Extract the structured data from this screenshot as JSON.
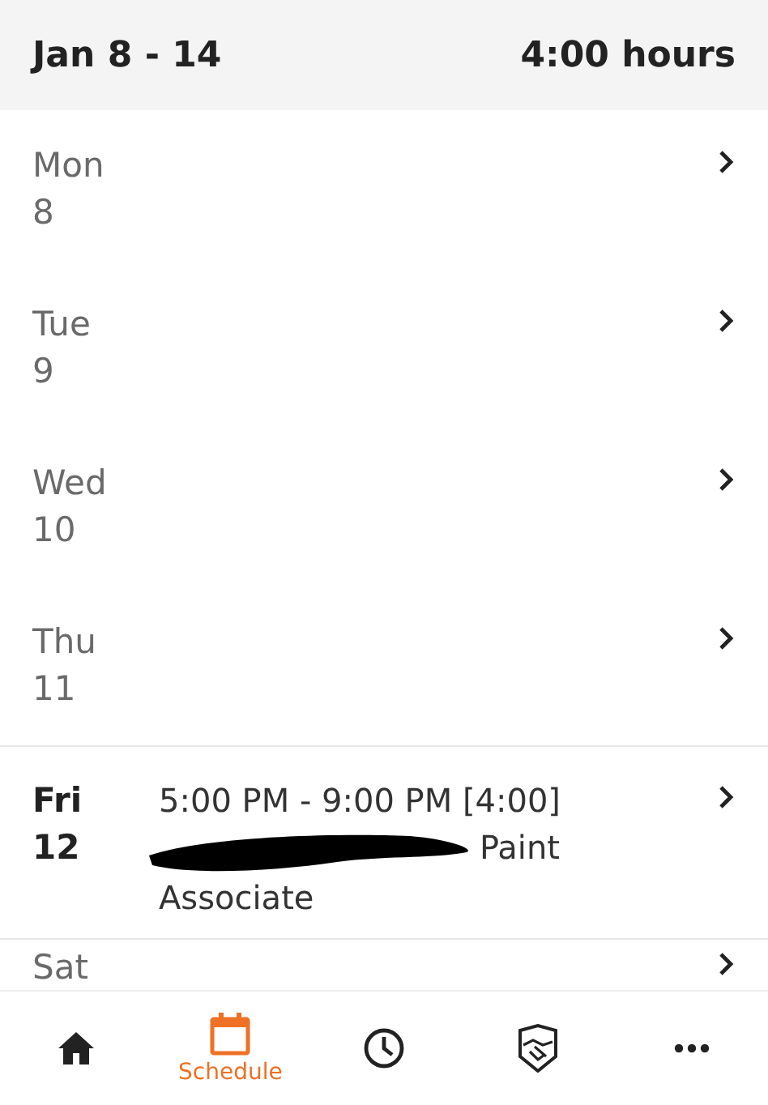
{
  "header": {
    "range": "Jan 8 - 14",
    "total": "4:00 hours"
  },
  "days": [
    {
      "name": "Mon",
      "date": "8",
      "has_shift": false
    },
    {
      "name": "Tue",
      "date": "9",
      "has_shift": false
    },
    {
      "name": "Wed",
      "date": "10",
      "has_shift": false
    },
    {
      "name": "Thu",
      "date": "11",
      "has_shift": false
    },
    {
      "name": "Fri",
      "date": "12",
      "has_shift": true,
      "shift": {
        "time": "5:00 PM - 9:00 PM [4:00]",
        "role_lines": [
          "Paint",
          "Associate"
        ],
        "redacted": true
      }
    },
    {
      "name": "Sat",
      "has_shift": false
    }
  ],
  "nav": [
    {
      "kind": "home",
      "selected": false
    },
    {
      "kind": "schedule",
      "label": "Schedule",
      "selected": true
    },
    {
      "kind": "clock",
      "selected": false
    },
    {
      "kind": "shield",
      "selected": false
    },
    {
      "kind": "more",
      "selected": false
    }
  ]
}
